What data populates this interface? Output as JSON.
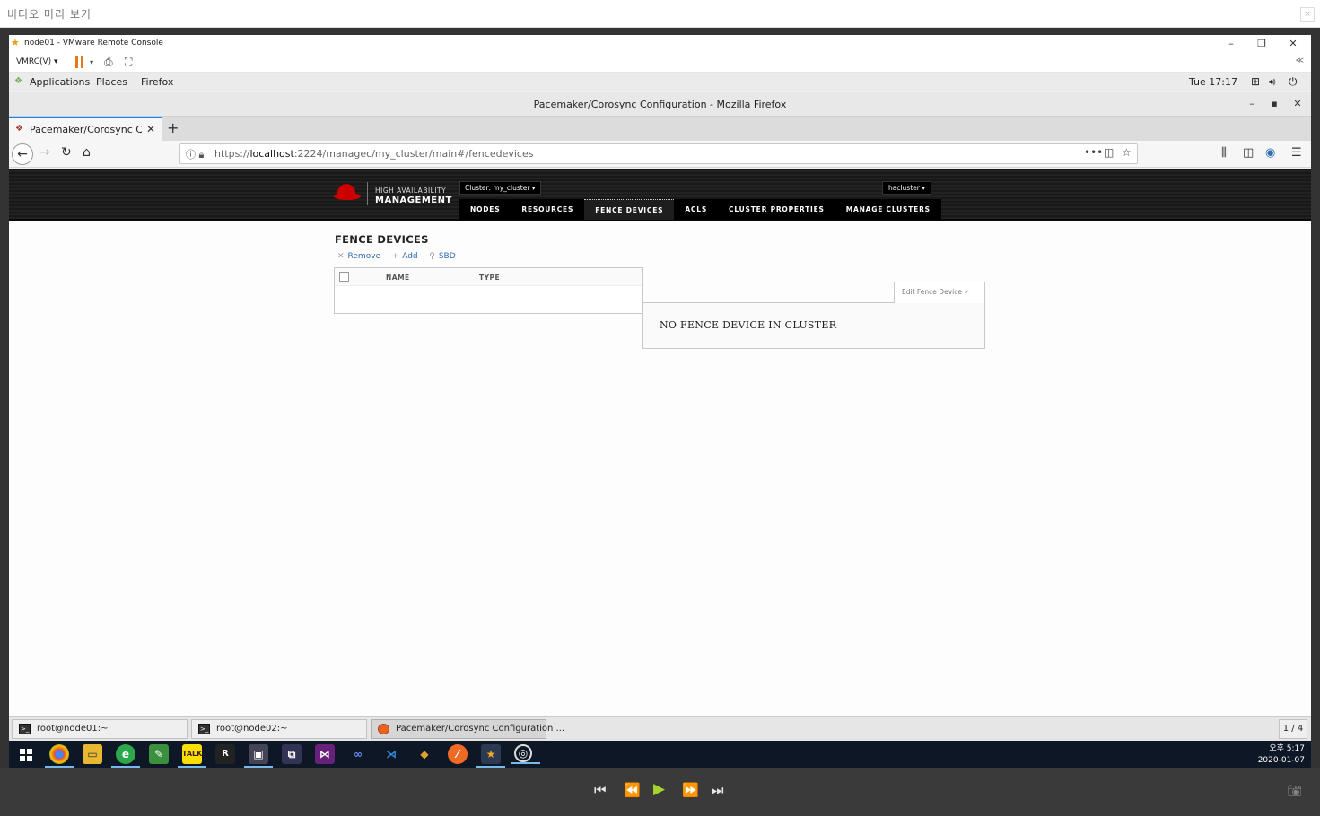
{
  "preview": {
    "title": "비디오 미리 보기",
    "close": "×"
  },
  "vmrc": {
    "title": "node01 - VMware Remote Console",
    "menu": "VMRC(V) ▾",
    "collapse": "≪",
    "window_buttons": {
      "minimize": "–",
      "restore": "❐",
      "close": "✕"
    }
  },
  "gnome_panel": {
    "items": [
      "Applications",
      "Places",
      "Firefox"
    ],
    "clock": "Tue 17:17"
  },
  "firefox": {
    "window_title": "Pacemaker/Corosync Configuration - Mozilla Firefox",
    "tab_title": "Pacemaker/Corosync Con",
    "url_scheme": "https://",
    "url_host": "localhost",
    "url_rest": ":2224/managec/my_cluster/main#/fencedevices",
    "window_buttons": {
      "minimize": "–",
      "maximize": "▪",
      "close": "✕"
    }
  },
  "pcs": {
    "brand_top": "HIGH AVAILABILITY",
    "brand_bottom": "MANAGEMENT",
    "cluster_selector": "Cluster: my_cluster ▾",
    "user_menu": "hacluster ▾",
    "nav": [
      "NODES",
      "RESOURCES",
      "FENCE DEVICES",
      "ACLS",
      "CLUSTER PROPERTIES",
      "MANAGE CLUSTERS"
    ],
    "active_nav": "FENCE DEVICES",
    "section_title": "FENCE DEVICES",
    "actions": {
      "remove": "Remove",
      "add": "Add",
      "sbd": "SBD"
    },
    "columns": [
      "NAME",
      "TYPE"
    ],
    "edit_tab": "Edit Fence Device ✓",
    "empty_message": "NO FENCE DEVICE IN CLUSTER"
  },
  "taskbar": {
    "tasks": [
      "root@node01:~",
      "root@node02:~",
      "Pacemaker/Corosync Configuration ..."
    ],
    "workspace": "1 / 4"
  },
  "windows_taskbar": {
    "time": "오후 5:17",
    "date": "2020-01-07"
  }
}
